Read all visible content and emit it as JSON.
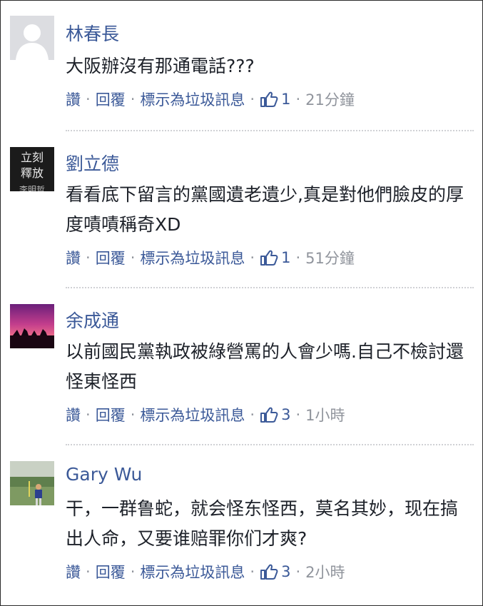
{
  "comments": [
    {
      "author": "林春長",
      "text": "大阪辦沒有那通電話???",
      "actions": {
        "like": "讚",
        "reply": "回覆",
        "spam": "標示為垃圾訊息"
      },
      "likes": "1",
      "time": "21分鐘",
      "avatar": "default-silhouette"
    },
    {
      "author": "劉立德",
      "text": "看看底下留言的黨國遺老遺少,真是對他們臉皮的厚度嘖嘖稱奇XD",
      "actions": {
        "like": "讚",
        "reply": "回覆",
        "spam": "標示為垃圾訊息"
      },
      "likes": "1",
      "time": "51分鐘",
      "avatar": "text-tile",
      "avatar_text": [
        "立刻",
        "釋放",
        "李明哲"
      ]
    },
    {
      "author": "余成通",
      "text": "以前國民黨執政被綠營罵的人會少嗎.自己不檢討還怪東怪西",
      "actions": {
        "like": "讚",
        "reply": "回覆",
        "spam": "標示為垃圾訊息"
      },
      "likes": "3",
      "time": "1小時",
      "avatar": "sunset-photo"
    },
    {
      "author": "Gary Wu",
      "text": "干，一群鲁蛇，就会怪东怪西，莫名其妙，现在搞出人命，又要谁赔罪你们才爽?",
      "actions": {
        "like": "讚",
        "reply": "回覆",
        "spam": "標示為垃圾訊息"
      },
      "likes": "3",
      "time": "2小時",
      "avatar": "golf-photo"
    }
  ],
  "colors": {
    "link": "#3b5998",
    "text": "#1d2129",
    "meta": "#90949c",
    "divider": "#d0d1d5"
  },
  "icons": {
    "like": "thumbs-up-icon"
  }
}
